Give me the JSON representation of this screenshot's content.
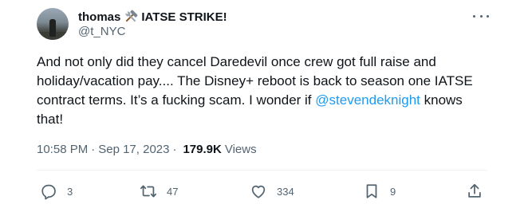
{
  "author": {
    "display_name": "thomas",
    "name_suffix": "IATSE STRIKE!",
    "handle": "@t_NYC"
  },
  "tweet": {
    "text_before_mention": "And not only did they cancel Daredevil once crew got full raise and holiday/vacation pay.... The Disney+ reboot is back to season one IATSE contract terms. It’s a fucking scam. I wonder if ",
    "mention": "@stevendeknight",
    "text_after_mention": " knows that!",
    "time": "10:58 PM",
    "separator": "·",
    "date": "Sep 17, 2023",
    "views_count": "179.9K",
    "views_label": "Views"
  },
  "actions": {
    "replies": "3",
    "retweets": "47",
    "likes": "334",
    "bookmarks": "9"
  },
  "icons": {
    "name_badge": "hammer-and-wrench-icon",
    "more": "more-horizontal-icon",
    "reply": "reply-icon",
    "retweet": "retweet-icon",
    "like": "heart-icon",
    "bookmark": "bookmark-icon",
    "share": "share-icon"
  },
  "colors": {
    "text": "#0f1419",
    "secondary": "#536471",
    "link": "#1d9bf0"
  }
}
